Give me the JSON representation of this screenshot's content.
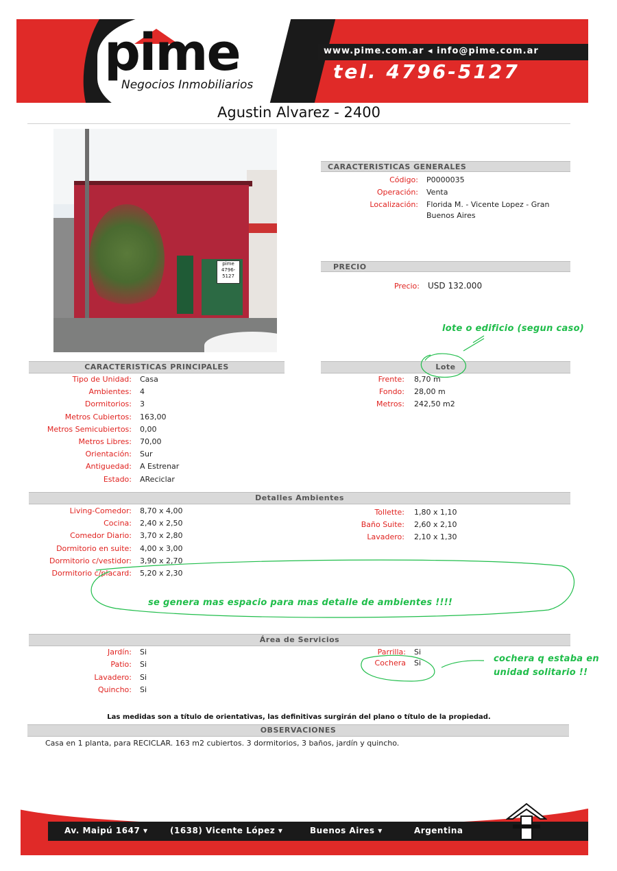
{
  "header": {
    "logo_text": "pime",
    "logo_sub": "Negocios Inmobiliarios",
    "web": "www.pime.com.ar  ◂  info@pime.com.ar",
    "tel": "tel. 4796-5127"
  },
  "title": "Agustin Alvarez - 2400",
  "photo_sign": "pime 4796-5127",
  "generales": {
    "heading": "CARACTERISTICAS GENERALES",
    "rows": [
      {
        "label": "Código:",
        "value": "P0000035"
      },
      {
        "label": "Operación:",
        "value": "Venta"
      },
      {
        "label": "Localización:",
        "value": "Florida M. - Vicente Lopez - Gran",
        "value2": "Buenos Aires"
      }
    ]
  },
  "precio": {
    "heading": "PRECIO",
    "label": "Precio:",
    "value": "USD 132.000"
  },
  "principales": {
    "heading": "CARACTERISTICAS PRINCIPALES",
    "rows": [
      {
        "label": "Tipo de Unidad:",
        "value": "Casa"
      },
      {
        "label": "Ambientes:",
        "value": "4"
      },
      {
        "label": "Dormitorios:",
        "value": "3"
      },
      {
        "label": "Metros Cubiertos:",
        "value": "163,00"
      },
      {
        "label": "Metros Semicubiertos:",
        "value": "0,00"
      },
      {
        "label": "Metros Libres:",
        "value": "70,00"
      },
      {
        "label": "Orientación:",
        "value": "Sur"
      },
      {
        "label": "Antiguedad:",
        "value": "A Estrenar"
      },
      {
        "label": "Estado:",
        "value": "AReciclar"
      }
    ]
  },
  "lote": {
    "heading": "Lote",
    "rows": [
      {
        "label": "Frente:",
        "value": "8,70 m"
      },
      {
        "label": "Fondo:",
        "value": "28,00 m"
      },
      {
        "label": "Metros:",
        "value": "242,50 m2"
      }
    ]
  },
  "ambientes": {
    "heading": "Detalles Ambientes",
    "left": [
      {
        "label": "Living-Comedor:",
        "value": "8,70 x 4,00"
      },
      {
        "label": "Cocina:",
        "value": "2,40 x 2,50"
      },
      {
        "label": "Comedor Diario:",
        "value": "3,70 x 2,80"
      },
      {
        "label": "Dormitorio en suite:",
        "value": "4,00 x 3,00"
      },
      {
        "label": "Dormitorio c/vestidor:",
        "value": "3,90 x 2,70"
      },
      {
        "label": "Dormitorio c/placard:",
        "value": "5,20 x 2,30"
      }
    ],
    "right": [
      {
        "label": "Tollette:",
        "value": "1,80 x 1,10"
      },
      {
        "label": "Baño Suite:",
        "value": "2,60 x 2,10"
      },
      {
        "label": "Lavadero:",
        "value": "2,10 x 1,30"
      }
    ]
  },
  "servicios": {
    "heading": "Área de Servicios",
    "left": [
      {
        "label": "Jardín:",
        "value": "Si"
      },
      {
        "label": "Patio:",
        "value": "Si"
      },
      {
        "label": "Lavadero:",
        "value": "Si"
      },
      {
        "label": "Quincho:",
        "value": "Si"
      }
    ],
    "right": [
      {
        "label": "Parrilla:",
        "value": "Si"
      },
      {
        "label": "Cochera",
        "value": "Si"
      }
    ]
  },
  "annotations": {
    "lote_note": "lote o edificio (segun caso)",
    "ambientes_note": "se genera mas espacio para mas detalle de ambientes !!!!",
    "cochera_note_1": "cochera q estaba en",
    "cochera_note_2": "unidad solitario !!"
  },
  "disclaimer": "Las medidas son a título de orientativas, las definitivas surgirán del plano o título de la propiedad.",
  "observaciones": {
    "heading": "OBSERVACIONES",
    "text": "Casa en 1 planta, para RECICLAR. 163 m2 cubiertos. 3 dormitorios, 3 baños, jardín y quincho."
  },
  "footer": {
    "items": [
      "Av. Maipú 1647  ▾",
      "(1638) Vicente López  ▾",
      "Buenos Aires  ▾",
      "Argentina"
    ]
  },
  "colors": {
    "brand_red": "#e02a28",
    "label_red": "#e0221f",
    "annotation_green": "#1fbd4a",
    "bar_gray": "#d9d9d9"
  }
}
